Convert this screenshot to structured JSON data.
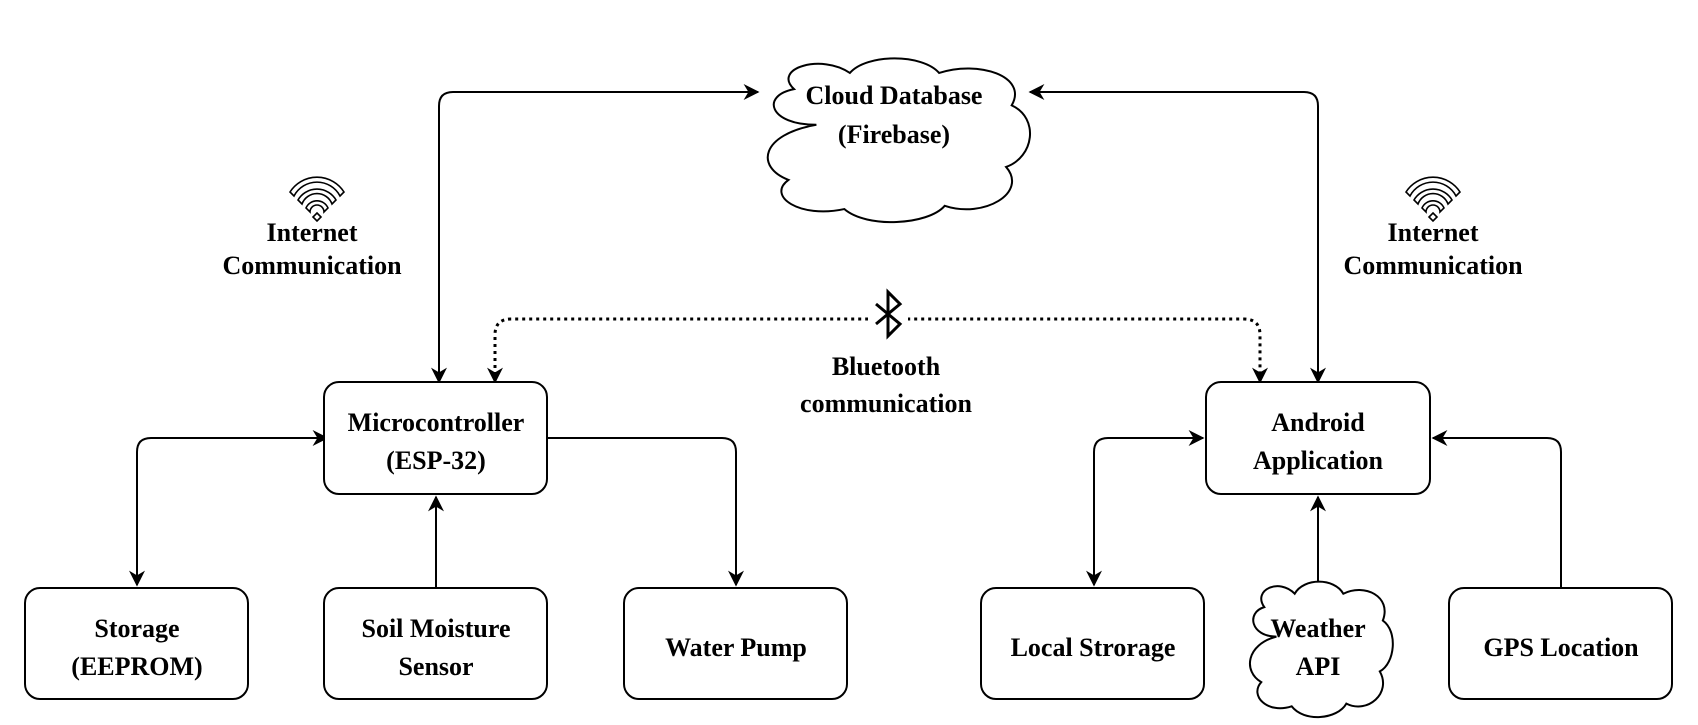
{
  "nodes": {
    "cloud_db": {
      "line1": "Cloud Database",
      "line2": "(Firebase)",
      "shape": "cloud"
    },
    "microcontroller": {
      "line1": "Microcontroller",
      "line2": "(ESP-32)"
    },
    "android": {
      "line1": "Android",
      "line2": "Application"
    },
    "storage": {
      "line1": "Storage",
      "line2": "(EEPROM)"
    },
    "soil": {
      "line1": "Soil Moisture",
      "line2": "Sensor"
    },
    "pump": {
      "line1": "Water Pump"
    },
    "local_storage": {
      "line1": "Local Strorage"
    },
    "weather": {
      "line1": "Weather",
      "line2": "API",
      "shape": "cloud"
    },
    "gps": {
      "line1": "GPS Location"
    }
  },
  "edge_labels": {
    "internet_left": {
      "line1": "Internet",
      "line2": "Communication",
      "icon": "wifi-icon"
    },
    "internet_right": {
      "line1": "Internet",
      "line2": "Communication",
      "icon": "wifi-icon"
    },
    "bluetooth": {
      "line1": "Bluetooth",
      "line2": "communication",
      "icon": "bluetooth-icon"
    }
  }
}
